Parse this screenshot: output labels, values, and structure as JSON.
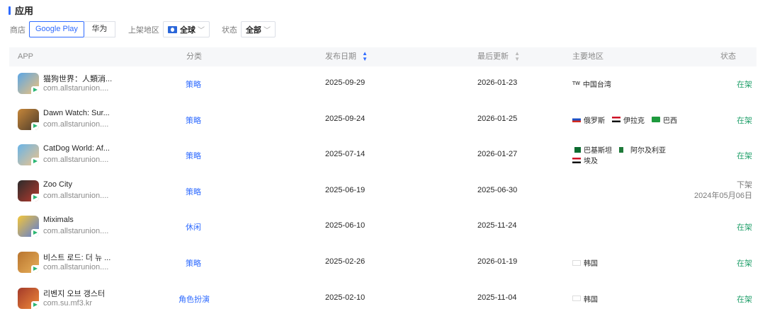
{
  "section_title": "应用",
  "filters": {
    "store_label": "商店",
    "stores": [
      "Google Play",
      "华为"
    ],
    "active_store": "Google Play",
    "region_label": "上架地区",
    "region_value": "全球",
    "status_label": "状态",
    "status_value": "全部"
  },
  "table": {
    "columns": [
      "APP",
      "分类",
      "发布日期",
      "最后更新",
      "主要地区",
      "状态"
    ],
    "rows": [
      {
        "name": "猫狗世界：人類消...",
        "pkg": "com.allstarunion....",
        "category": "策略",
        "release": "2025-09-29",
        "updated": "2026-01-23",
        "regions": [
          [
            "中国台湾"
          ]
        ],
        "region_flags": [
          [
            "tw"
          ]
        ],
        "status": "在架",
        "status_date": ""
      },
      {
        "name": "Dawn Watch: Sur...",
        "pkg": "com.allstarunion....",
        "category": "策略",
        "release": "2025-09-24",
        "updated": "2026-01-25",
        "regions": [
          [
            "俄罗斯",
            "伊拉克",
            "巴西"
          ]
        ],
        "region_flags": [
          [
            "ru",
            "iq",
            "br"
          ]
        ],
        "status": "在架",
        "status_date": ""
      },
      {
        "name": "CatDog World: Af...",
        "pkg": "com.allstarunion....",
        "category": "策略",
        "release": "2025-07-14",
        "updated": "2026-01-27",
        "regions": [
          [
            "巴基斯坦",
            "阿尔及利亚"
          ],
          [
            "埃及"
          ]
        ],
        "region_flags": [
          [
            "pk",
            "dz"
          ],
          [
            "eg"
          ]
        ],
        "status": "在架",
        "status_date": ""
      },
      {
        "name": "Zoo City",
        "pkg": "com.allstarunion....",
        "category": "策略",
        "release": "2025-06-19",
        "updated": "2025-06-30",
        "regions": [],
        "region_flags": [],
        "status": "下架",
        "status_date": "2024年05月06日"
      },
      {
        "name": "Miximals",
        "pkg": "com.allstarunion....",
        "category": "休闲",
        "release": "2025-06-10",
        "updated": "2025-11-24",
        "regions": [],
        "region_flags": [],
        "status": "在架",
        "status_date": ""
      },
      {
        "name": "비스트 로드: 더 뉴 ...",
        "pkg": "com.allstarunion....",
        "category": "策略",
        "release": "2025-02-26",
        "updated": "2026-01-19",
        "regions": [
          [
            "韩国"
          ]
        ],
        "region_flags": [
          [
            "kr"
          ]
        ],
        "status": "在架",
        "status_date": ""
      },
      {
        "name": "리벤지 오브 갱스터",
        "pkg": "com.su.mf3.kr",
        "category": "角色扮演",
        "release": "2025-02-10",
        "updated": "2025-11-04",
        "regions": [
          [
            "韩国"
          ]
        ],
        "region_flags": [
          [
            "kr"
          ]
        ],
        "status": "在架",
        "status_date": ""
      }
    ],
    "icon_names": [
      "catdog-icon",
      "dawn-watch-icon",
      "catdog-world-icon",
      "zoo-city-icon",
      "miximals-icon",
      "beast-lord-icon",
      "revenge-gangster-icon"
    ],
    "icon_colors": [
      [
        "#5aa6e6",
        "#f1c27a"
      ],
      [
        "#c7873a",
        "#4a3a2a"
      ],
      [
        "#68b4e8",
        "#f0c48a"
      ],
      [
        "#2b2b2b",
        "#b83a2e"
      ],
      [
        "#f3c63a",
        "#5a7ad8"
      ],
      [
        "#b8742e",
        "#e8b05a"
      ],
      [
        "#a33a2a",
        "#f08a3a"
      ]
    ]
  },
  "colors": {
    "accent": "#2f6bff",
    "status_on": "#22a06b",
    "status_off": "#7a7a7a"
  }
}
